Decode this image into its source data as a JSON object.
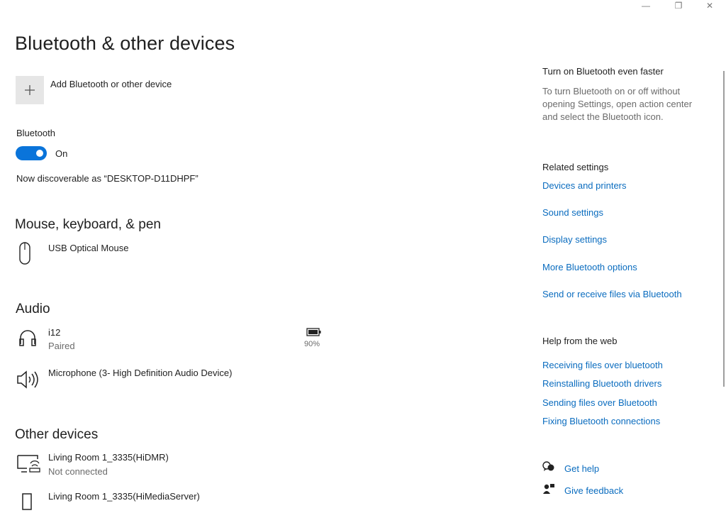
{
  "window": {
    "minimize": "—",
    "restore": "❐",
    "close": "✕"
  },
  "page_title": "Bluetooth & other devices",
  "add_device": {
    "label": "Add Bluetooth or other device"
  },
  "bluetooth": {
    "section_label": "Bluetooth",
    "toggle_state": "On",
    "discoverable": "Now discoverable as “DESKTOP-D11DHPF”"
  },
  "sections": {
    "mouse": {
      "title": "Mouse, keyboard, & pen",
      "devices": [
        {
          "name": "USB Optical Mouse",
          "icon": "mouse-icon"
        }
      ]
    },
    "audio": {
      "title": "Audio",
      "devices": [
        {
          "name": "i12",
          "status": "Paired",
          "battery": "90%",
          "icon": "headphones-icon"
        },
        {
          "name": "Microphone (3- High Definition Audio Device)",
          "icon": "speaker-icon"
        }
      ]
    },
    "other": {
      "title": "Other devices",
      "devices": [
        {
          "name": "Living Room 1_3335(HiDMR)",
          "status": "Not connected",
          "icon": "media-renderer-icon"
        },
        {
          "name": "Living Room 1_3335(HiMediaServer)",
          "icon": "media-server-icon"
        }
      ]
    }
  },
  "sidebar": {
    "faster": {
      "title": "Turn on Bluetooth even faster",
      "lines": [
        "To turn Bluetooth on or off without",
        "opening Settings, open action center",
        "and select the Bluetooth icon."
      ]
    },
    "related": {
      "title": "Related settings",
      "links": [
        "Devices and printers",
        "Sound settings",
        "Display settings",
        "More Bluetooth options",
        "Send or receive files via Bluetooth"
      ]
    },
    "help": {
      "title": "Help from the web",
      "links": [
        "Receiving files over bluetooth",
        "Reinstalling Bluetooth drivers",
        "Sending files over Bluetooth",
        "Fixing Bluetooth connections"
      ]
    },
    "get_help": "Get help",
    "give_feedback": "Give feedback"
  },
  "colors": {
    "accent": "#0a74da",
    "link": "#0a6cbf",
    "muted": "#6b6b6b"
  }
}
